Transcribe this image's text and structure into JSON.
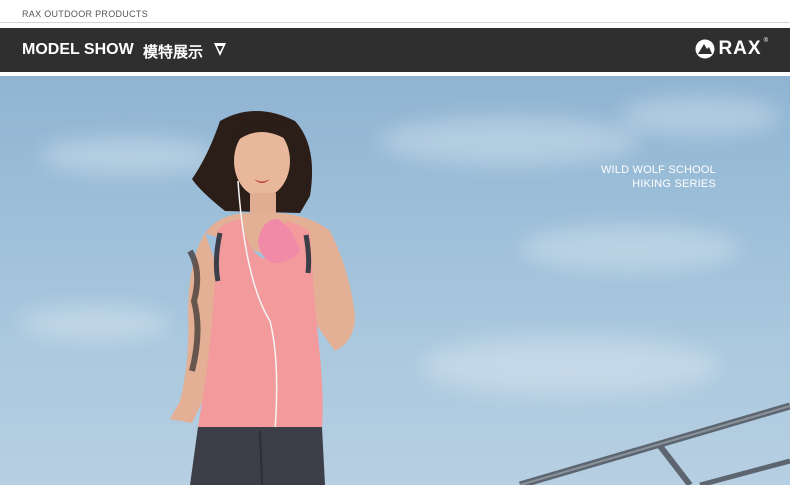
{
  "header": {
    "top_label": "RAX OUTDOOR PRODUCTS",
    "banner_title": "MODEL SHOW",
    "banner_title_cn": "模特展示",
    "shield_icon": "chevron-shield-icon",
    "logo_text": "RAX",
    "logo_mark": "rax-mountain-logo-icon"
  },
  "hero": {
    "line1": "WILD WOLF SCHOOL",
    "line2": "HIKING SERIES",
    "colors": {
      "sky_top": "#8fb4d2",
      "sky_bottom": "#b7cfe2",
      "tank_top": "#f39a9c",
      "leggings": "#3c3f47"
    }
  }
}
